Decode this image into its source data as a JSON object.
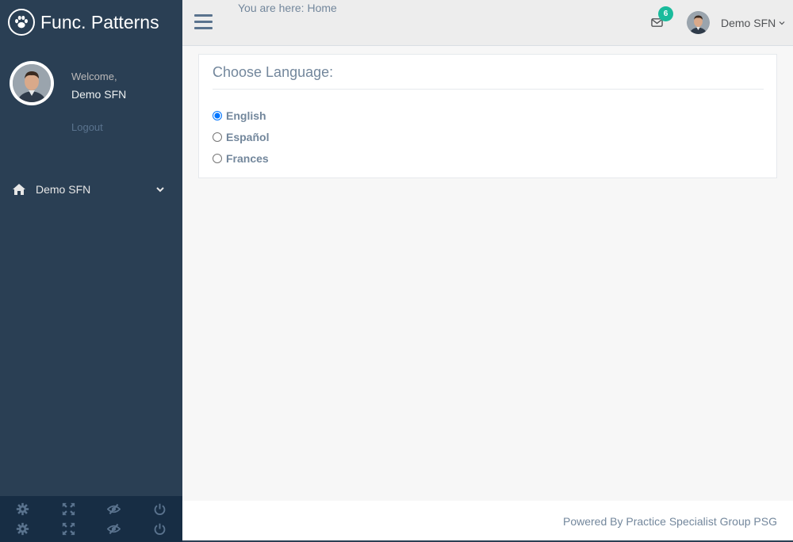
{
  "brand": {
    "title": "Func. Patterns",
    "icon": "paw-icon"
  },
  "profile": {
    "welcome": "Welcome,",
    "name": "Demo SFN",
    "logout": "Logout"
  },
  "sidebar": {
    "menu": [
      {
        "label": "Demo SFN",
        "icon": "home-icon"
      }
    ]
  },
  "topnav": {
    "breadcrumb_prefix": "You are here: ",
    "breadcrumb_home": "Home",
    "mail_count": "6",
    "user_name": "Demo SFN"
  },
  "panel": {
    "title": "Choose Language:",
    "options": [
      {
        "label": "English",
        "checked": true
      },
      {
        "label": "Español",
        "checked": false
      },
      {
        "label": "Frances",
        "checked": false
      }
    ]
  },
  "footer": {
    "text": "Powered By Practice Specialist Group PSG"
  },
  "sidebar_footer": {
    "icons": [
      "gear-icon",
      "fullscreen-icon",
      "eye-slash-icon",
      "power-icon"
    ]
  },
  "colors": {
    "sidebar": "#2a3f54",
    "accent": "#1abb9c",
    "text": "#73879c",
    "footer_bar": "#172d44"
  }
}
